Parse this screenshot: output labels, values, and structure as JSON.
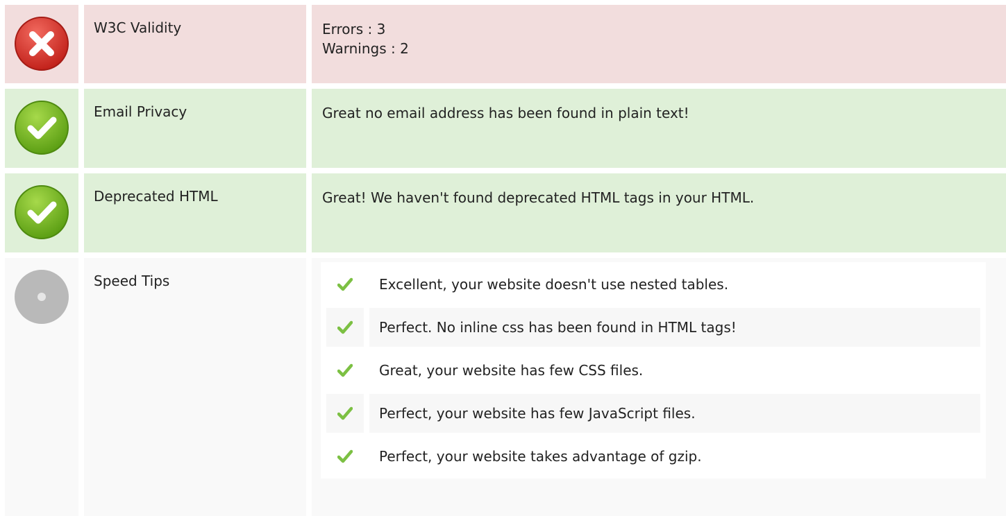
{
  "colors": {
    "error_bg": "#f2dddd",
    "ok_bg": "#dff0d8",
    "neutral_bg": "#f9f9f9",
    "error_icon": "#d9332b",
    "ok_icon": "#6fb51d",
    "neutral_icon": "#b9b9b9",
    "check": "#7cc043"
  },
  "rows": [
    {
      "status": "error",
      "icon": "error-cross-icon",
      "label": "W3C Validity",
      "value_lines": [
        "Errors : 3",
        "Warnings : 2"
      ]
    },
    {
      "status": "ok",
      "icon": "success-check-icon",
      "label": "Email Privacy",
      "value_lines": [
        "Great no email address has been found in plain text!"
      ]
    },
    {
      "status": "ok",
      "icon": "success-check-icon",
      "label": "Deprecated HTML",
      "value_lines": [
        "Great! We haven't found deprecated HTML tags in your HTML."
      ]
    },
    {
      "status": "neutral",
      "icon": "neutral-dot-icon",
      "label": "Speed Tips",
      "tips": [
        {
          "icon": "checkmark-icon",
          "text": "Excellent, your website doesn't use nested tables."
        },
        {
          "icon": "checkmark-icon",
          "text": "Perfect. No inline css has been found in HTML tags!"
        },
        {
          "icon": "checkmark-icon",
          "text": "Great, your website has few CSS files."
        },
        {
          "icon": "checkmark-icon",
          "text": "Perfect, your website has few JavaScript files."
        },
        {
          "icon": "checkmark-icon",
          "text": "Perfect, your website takes advantage of gzip."
        }
      ]
    }
  ]
}
